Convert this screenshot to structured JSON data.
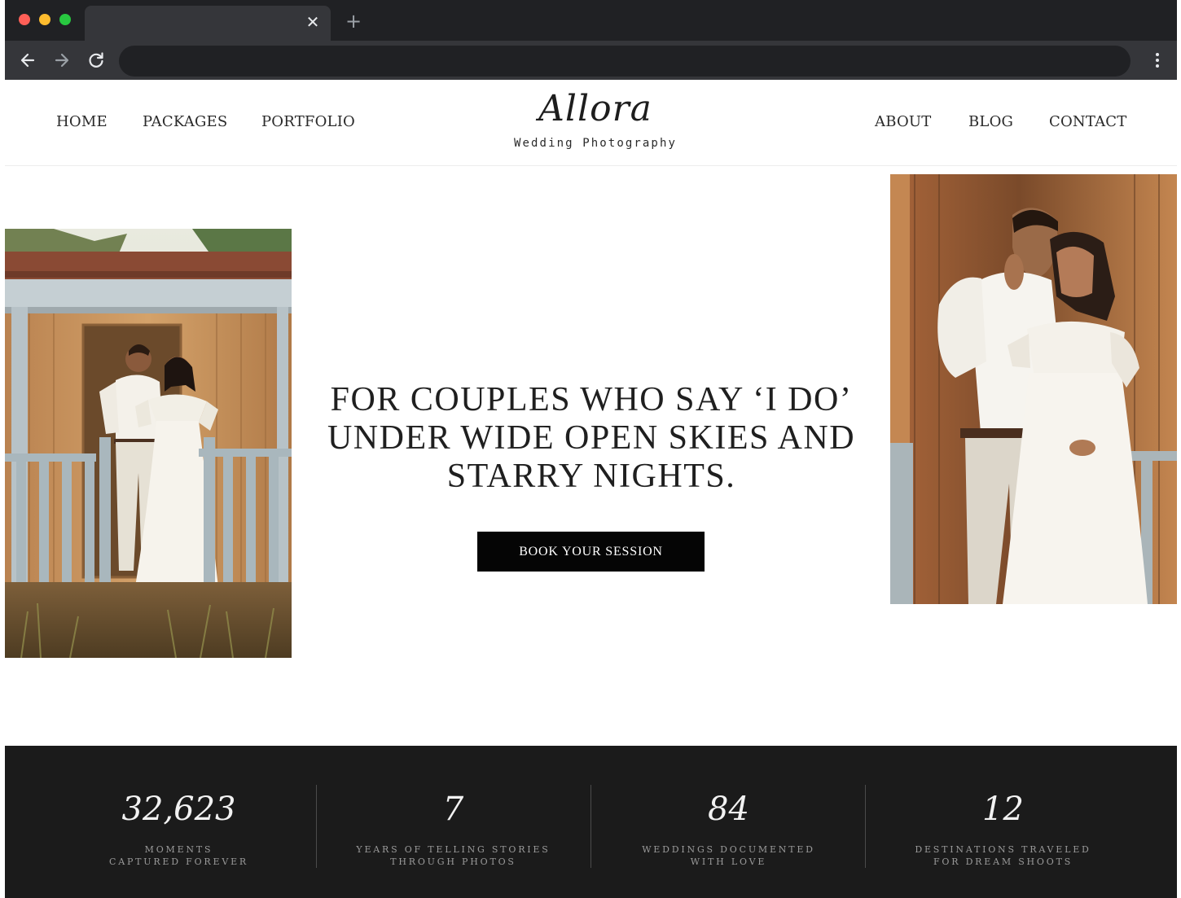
{
  "browser": {
    "tab_close_glyph": "✕",
    "new_tab_glyph": "+",
    "address_value": "",
    "icons": {
      "back": "arrow-left-icon",
      "forward": "arrow-right-icon",
      "reload": "reload-icon",
      "menu": "kebab-menu-icon",
      "close": "close-icon",
      "new_tab": "plus-icon"
    },
    "colors": {
      "titlebar": "#202124",
      "toolbar": "#35363a",
      "close_red": "#ff5f57",
      "minimize_yellow": "#febc2e",
      "maximize_green": "#28c840"
    }
  },
  "site": {
    "nav_left": [
      "HOME",
      "PACKAGES",
      "PORTFOLIO"
    ],
    "nav_right": [
      "ABOUT",
      "BLOG",
      "CONTACT"
    ],
    "logo": {
      "script": "Allora",
      "subtitle": "Wedding Photography"
    },
    "hero": {
      "headline": "FOR COUPLES WHO SAY ‘I DO’ UNDER WIDE OPEN SKIES AND STARRY NIGHTS.",
      "cta_label": "BOOK YOUR SESSION"
    },
    "stats": [
      {
        "number": "32,623",
        "caption_line1": "MOMENTS",
        "caption_line2": "CAPTURED FOREVER"
      },
      {
        "number": "7",
        "caption_line1": "YEARS OF TELLING STORIES",
        "caption_line2": "THROUGH PHOTOS"
      },
      {
        "number": "84",
        "caption_line1": "WEDDINGS DOCUMENTED",
        "caption_line2": "WITH LOVE"
      },
      {
        "number": "12",
        "caption_line1": "DESTINATIONS TRAVELED",
        "caption_line2": "FOR DREAM SHOOTS"
      }
    ],
    "colors": {
      "stats_background": "#1b1b1b",
      "cta_background": "#050505",
      "text_dark": "#1f1f1f"
    }
  }
}
